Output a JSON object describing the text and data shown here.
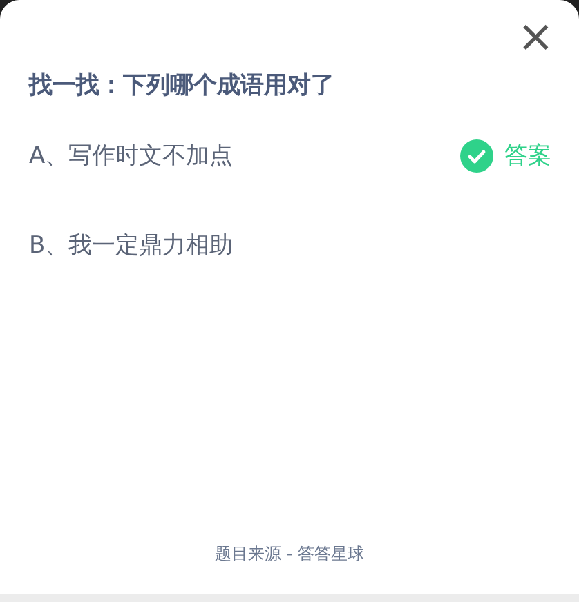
{
  "close_button": "×",
  "question": "找一找：下列哪个成语用对了",
  "options": [
    {
      "text": "A、写作时文不加点",
      "correct": true,
      "answer_label": "答案"
    },
    {
      "text": "B、我一定鼎力相助",
      "correct": false
    }
  ],
  "footer": "题目来源 - 答答星球"
}
